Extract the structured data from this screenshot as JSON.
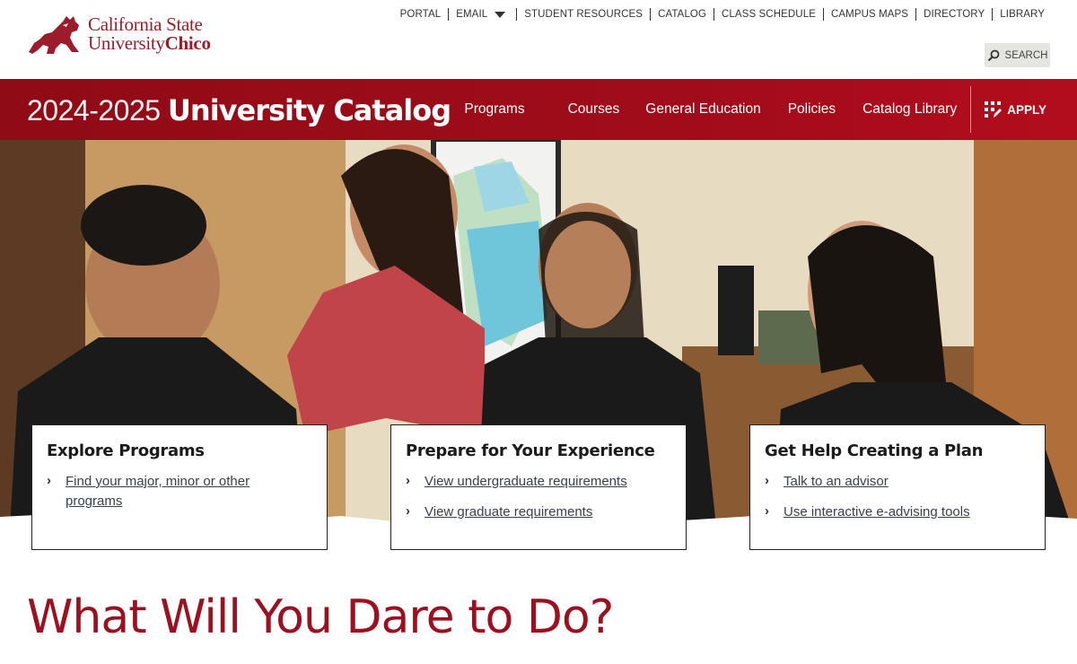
{
  "brand": {
    "line1": "California State",
    "line2_a": "University",
    "line2_b": "Chico",
    "mascot_icon": "wildcat-logo-icon",
    "brand_color": "#9d1c2b"
  },
  "utility_nav": {
    "items": [
      "PORTAL",
      "EMAIL",
      "STUDENT RESOURCES",
      "CATALOG",
      "CLASS SCHEDULE",
      "CAMPUS MAPS",
      "DIRECTORY",
      "LIBRARY"
    ],
    "search_label": "SEARCH"
  },
  "catalog_bar": {
    "year": "2024-2025",
    "title": "University Catalog",
    "nav": [
      "Programs",
      "Courses",
      "General Education",
      "Policies",
      "Catalog Library"
    ],
    "apply_label": "APPLY",
    "bar_color": "#a00c1a"
  },
  "cards": [
    {
      "title": "Explore Programs",
      "links": [
        "Find your major, minor or other programs"
      ]
    },
    {
      "title": "Prepare for Your Experience",
      "links": [
        "View undergraduate requirements",
        "View graduate requirements"
      ]
    },
    {
      "title": "Get Help Creating a Plan",
      "links": [
        "Talk to an advisor",
        "Use interactive e-advising tools"
      ]
    }
  ],
  "main": {
    "heading": "What Will You Dare to Do?"
  }
}
